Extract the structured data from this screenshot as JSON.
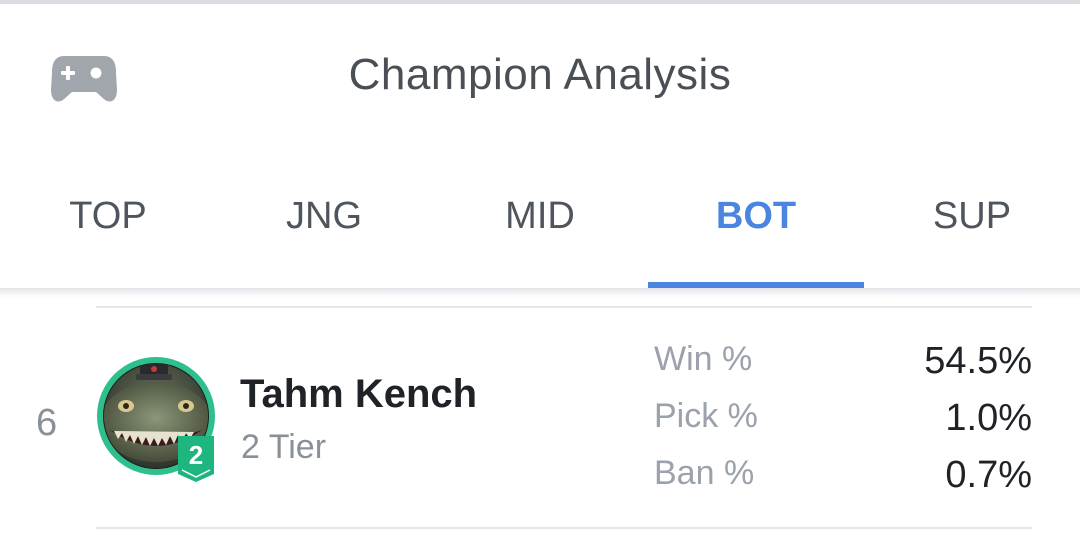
{
  "header": {
    "title": "Champion Analysis",
    "menu_icon": "gamepad-icon"
  },
  "tabs": [
    {
      "label": "TOP",
      "active": false
    },
    {
      "label": "JNG",
      "active": false
    },
    {
      "label": "MID",
      "active": false
    },
    {
      "label": "BOT",
      "active": true
    },
    {
      "label": "SUP",
      "active": false
    }
  ],
  "champion": {
    "rank": "6",
    "name": "Tahm Kench",
    "tier_label": "2 Tier",
    "tier_badge": "2",
    "stats": [
      {
        "label": "Win %",
        "value": "54.5%"
      },
      {
        "label": "Pick %",
        "value": "1.0%"
      },
      {
        "label": "Ban %",
        "value": "0.7%"
      }
    ]
  },
  "colors": {
    "accent": "#4a86e0",
    "tier_badge": "#1fb57e",
    "text_primary": "#1f2226",
    "text_secondary": "#8a9098"
  }
}
